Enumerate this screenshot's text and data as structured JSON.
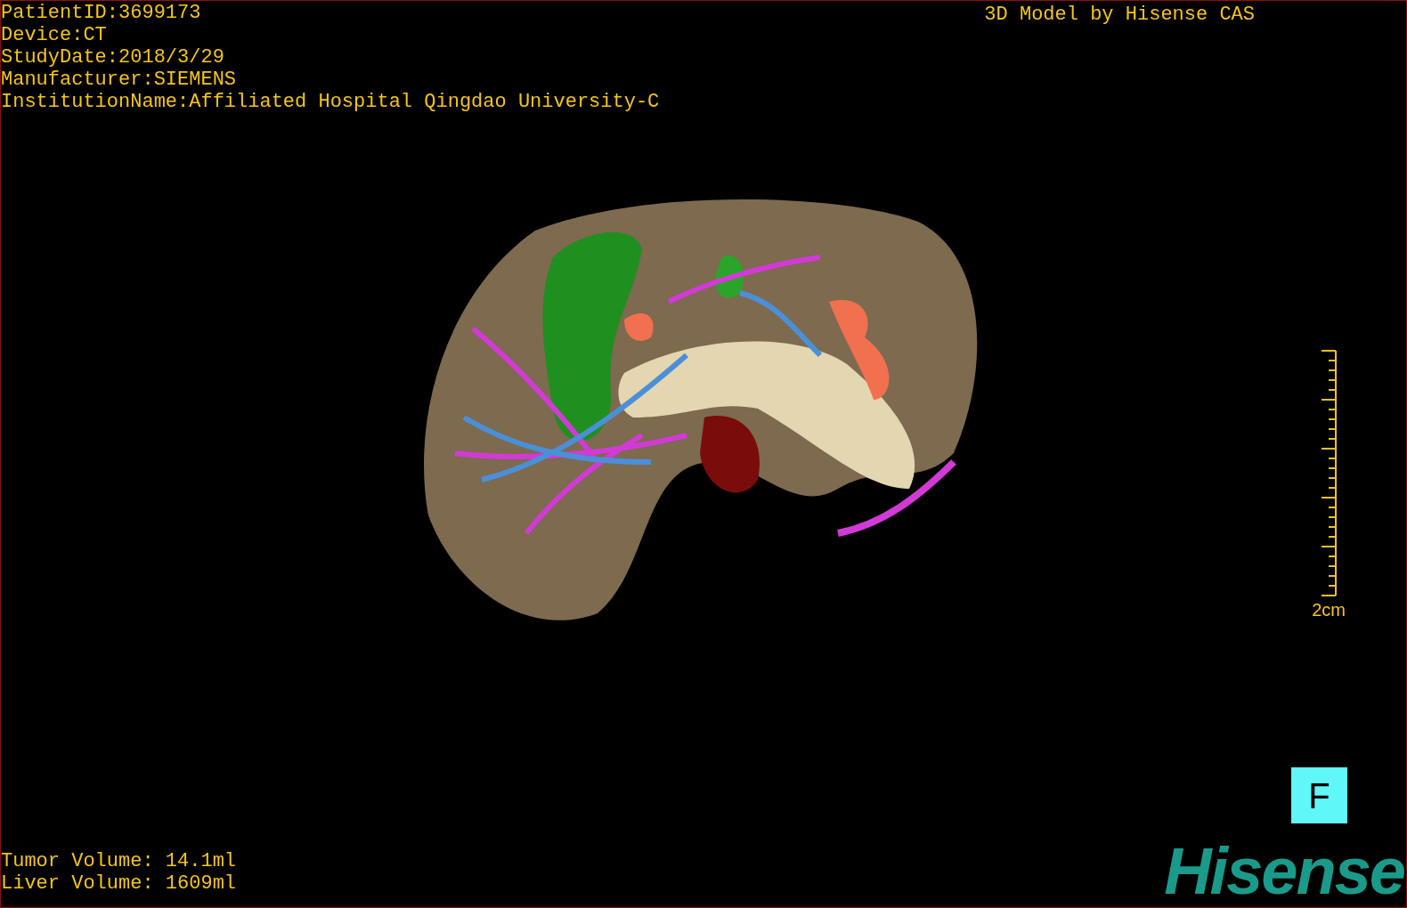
{
  "study_info": [
    "PatientID:3699173",
    "Device:CT",
    "StudyDate:2018/3/29",
    "Manufacturer:SIEMENS",
    "InstitutionName:Affiliated Hospital Qingdao University-C"
  ],
  "model_credit": "3D Model by Hisense CAS",
  "scale_bar": {
    "label": "2cm"
  },
  "volumes": [
    "Tumor Volume: 14.1ml",
    "Liver Volume: 1609ml"
  ],
  "view_button": "F",
  "logo": "Hisense"
}
